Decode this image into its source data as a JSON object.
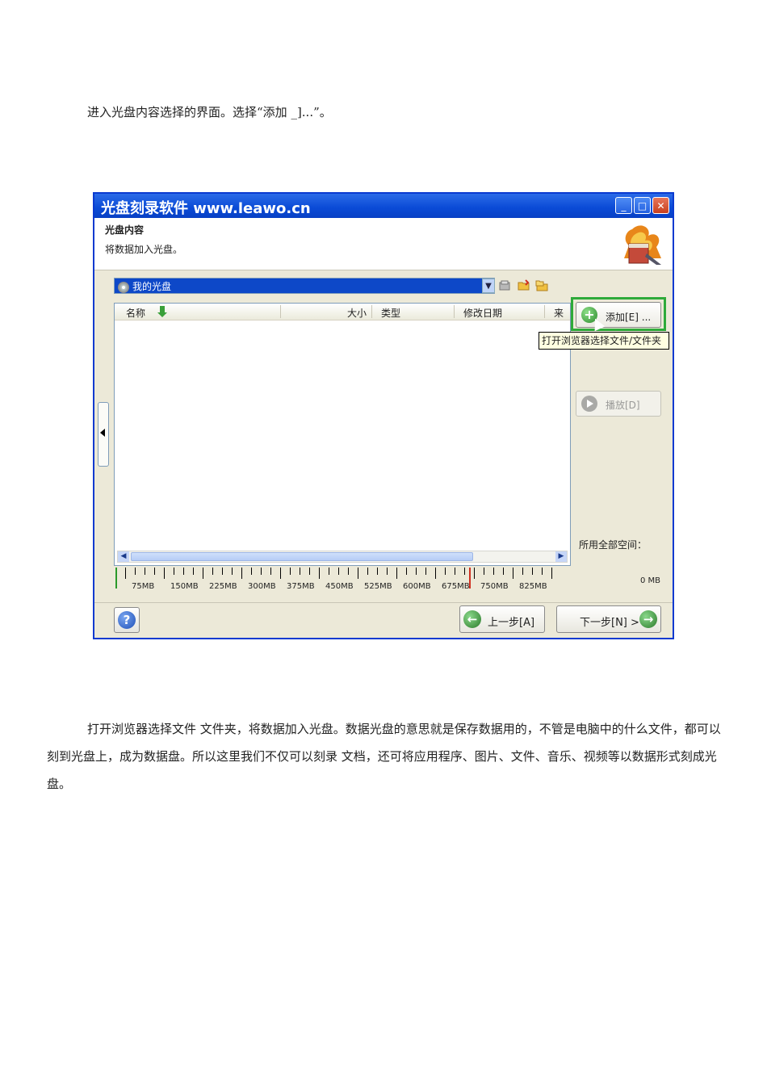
{
  "text": {
    "intro": "进入光盘内容选择的界面。选择“添加 _]...”。",
    "body": "打开浏览器选择文件 文件夹，将数据加入光盘。数据光盘的意思就是保存数据用的，不管是电脑中的什么文件，都可以刻到光盘上，成为数据盘。所以这里我们不仅可以刻录 文档，还可将应用程序、图片、文件、音乐、视频等以数据形式刻成光盘。"
  },
  "window": {
    "title": "光盘刻录软件 www.leawo.cn",
    "minimize": "_",
    "maximize": "□",
    "close": "✕",
    "heading": "光盘内容",
    "subheading": "将数据加入光盘。",
    "combo_value": "我的光盘",
    "columns": [
      "名称",
      "大小",
      "类型",
      "修改日期",
      "来"
    ],
    "add_button": "添加[E] ...",
    "tooltip": "打开浏览器选择文件/文件夹",
    "play_button": "播放[D]",
    "space_label": "所用全部空间：",
    "space_value": "0 MB",
    "ruler_labels": [
      "75MB",
      "150MB",
      "225MB",
      "300MB",
      "375MB",
      "450MB",
      "525MB",
      "600MB",
      "675MB",
      "750MB",
      "825MB"
    ],
    "prev_button": "上一步[A]",
    "next_button": "下一步[N] >",
    "help": "?"
  },
  "colors": {
    "titlebar": "#0a4ad6",
    "highlight_box": "#2eaa3a",
    "limit_marker": "#d03020",
    "start_marker": "#2a9a2a"
  },
  "icons": [
    "disc-icon",
    "plus-icon",
    "play-icon",
    "help-icon",
    "back-arrow-icon",
    "forward-arrow-icon",
    "folder-icon"
  ]
}
